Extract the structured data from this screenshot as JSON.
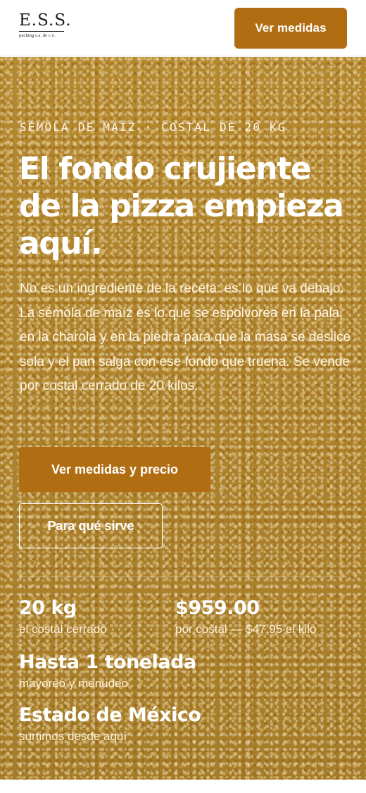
{
  "header": {
    "logo_main": "E.S.S.",
    "logo_sub": "packing s.a. de c.v.",
    "cta_label": "Ver medidas"
  },
  "hero": {
    "eyebrow": "SÉMOLA DE MAÍZ · COSTAL DE 20 KG",
    "headline": "El fondo crujiente de la pizza empieza aquí.",
    "body": "No es un ingrediente de la receta: es lo que va debajo. La sémola de maíz es lo que se espolvorea en la pala, en la charola y en la piedra para que la masa se deslice sola y el pan salga con ese fondo que truena. Se vende por costal cerrado de 20 kilos.",
    "primary_button": "Ver medidas y precio",
    "secondary_button": "Para qué sirve"
  },
  "stats": [
    {
      "value": "20 kg",
      "label": "el costal cerrado"
    },
    {
      "value": "$959.00",
      "label": "por costal — $47.95 el kilo"
    },
    {
      "value": "Hasta 1 tonelada",
      "label": "mayoreo y menudeo"
    },
    {
      "value": "Estado de México",
      "label": "surtimos desde aquí"
    }
  ],
  "colors": {
    "accent": "#b06d12",
    "background_texture": "#d9a63a",
    "text_on_hero": "#ffffff"
  }
}
